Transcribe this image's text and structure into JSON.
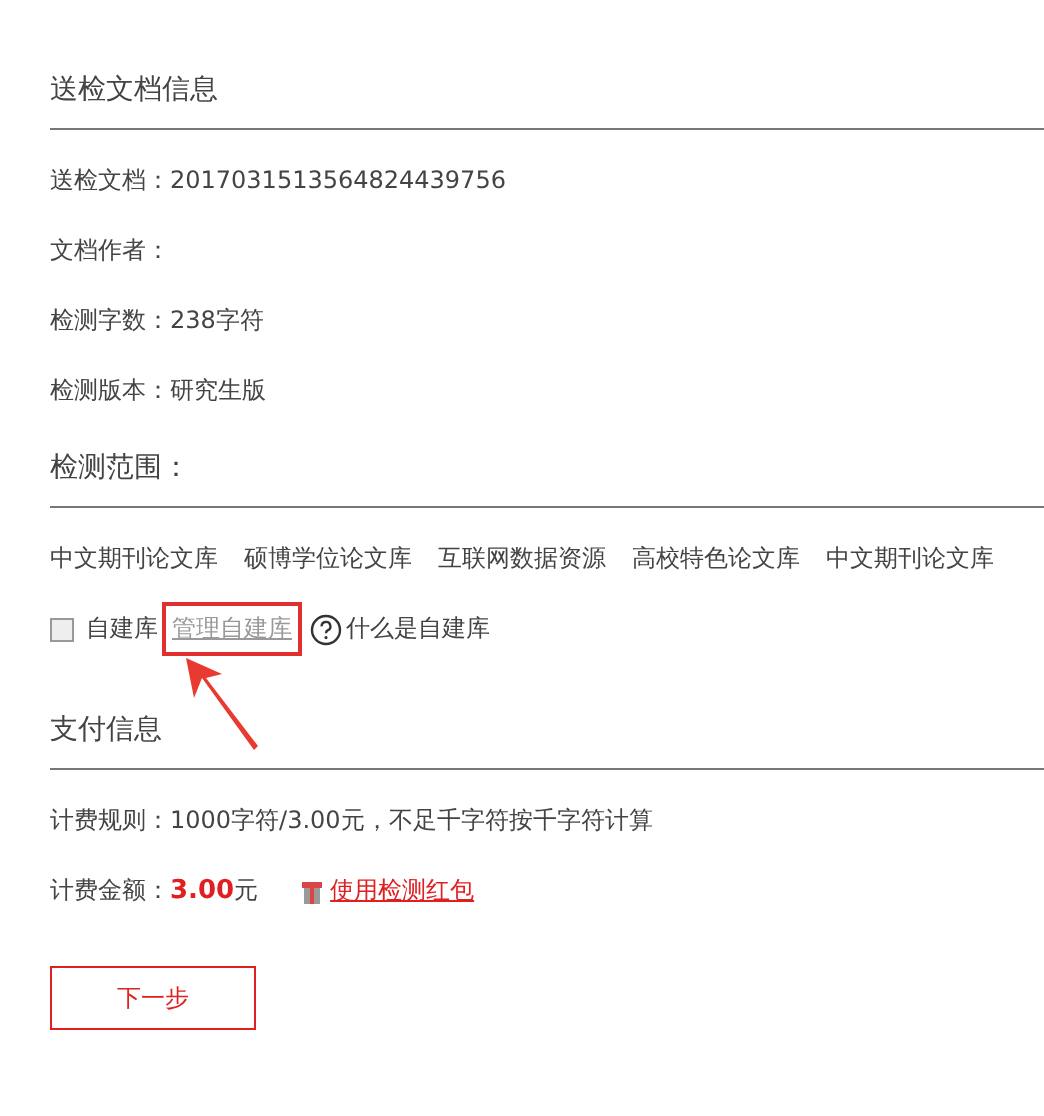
{
  "document_section": {
    "title": "送检文档信息",
    "fields": [
      {
        "label": "送检文档：",
        "value": "2017031513564824439756"
      },
      {
        "label": "文档作者："
      },
      {
        "label": "检测字数：",
        "value": "238字符"
      },
      {
        "label": "检测版本：",
        "value": "研究生版"
      }
    ]
  },
  "scope_section": {
    "title": "检测范围：",
    "libraries": [
      "中文期刊论文库",
      "硕博学位论文库",
      "互联网数据资源",
      "高校特色论文库",
      "中文期刊论文库"
    ],
    "own_library": {
      "label": "自建库",
      "checked": false
    },
    "manage_link": {
      "label": "管理自建库",
      "highlighted": true
    },
    "help": {
      "label": "什么是自建库"
    }
  },
  "payment_section": {
    "title": "支付信息",
    "rule": "计费规则：1000字符/3.00元，不足千字符按千字符计算",
    "amount": "计费金额：**3.00**元",
    "red_packet_link": "使用检测红包"
  },
  "next_button": "下一步"
}
